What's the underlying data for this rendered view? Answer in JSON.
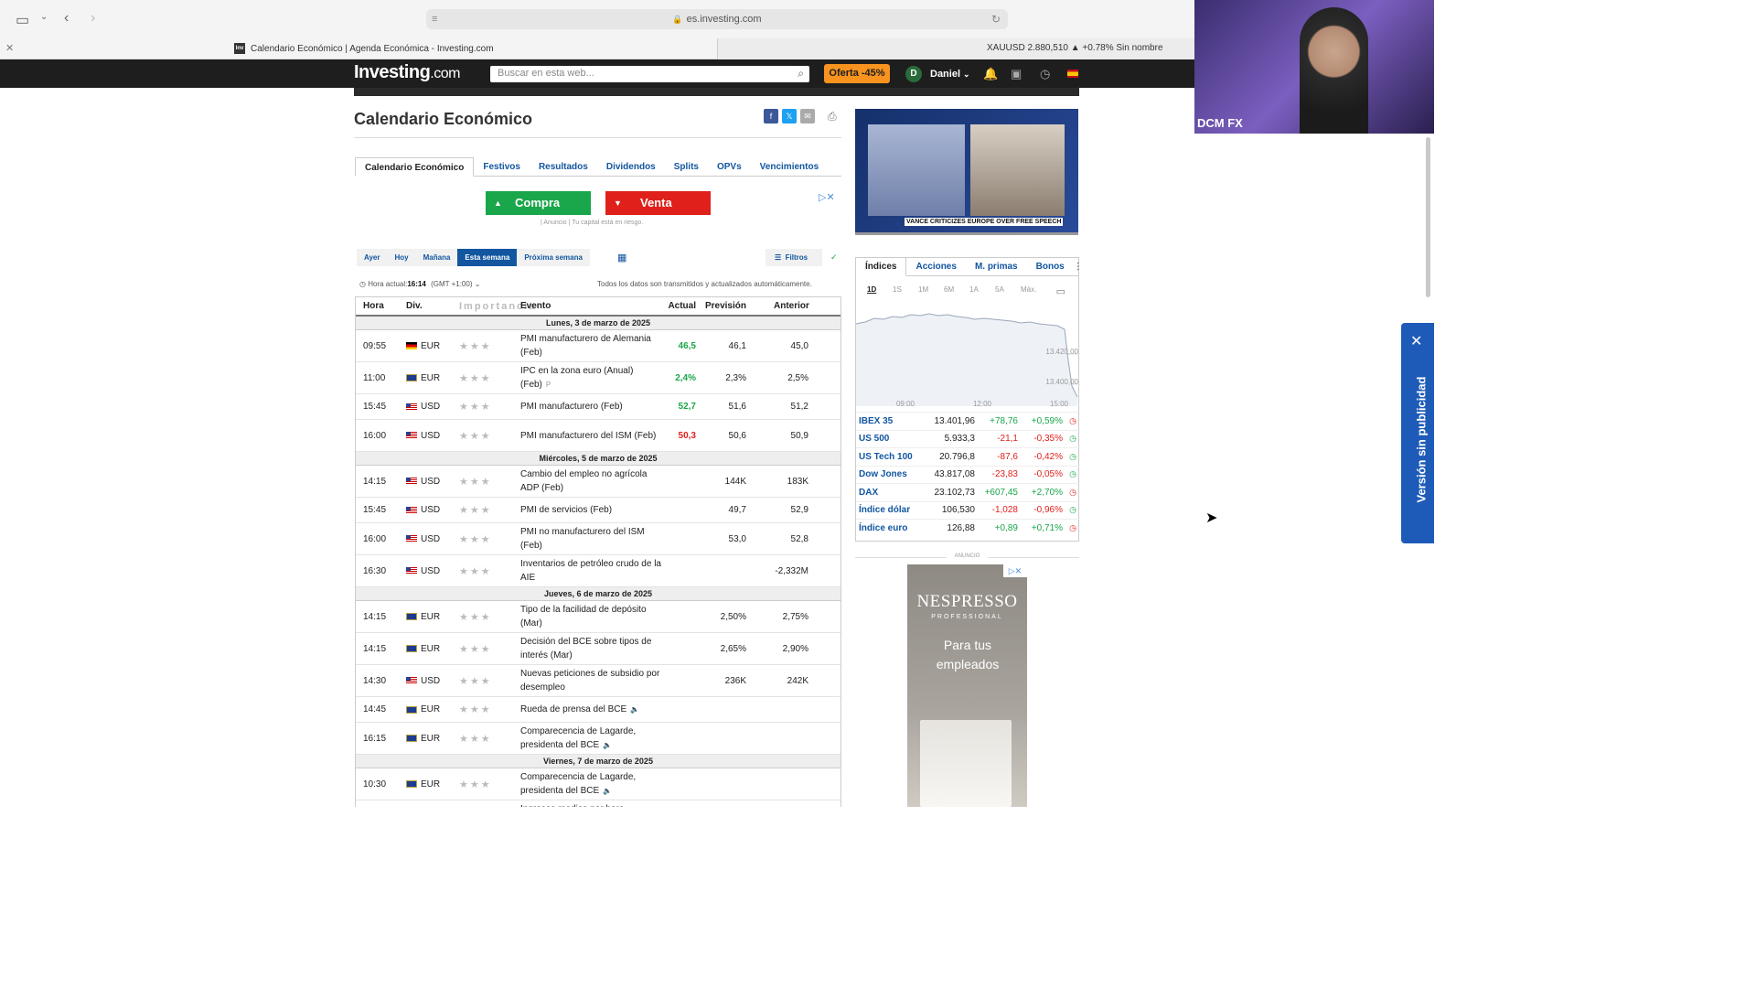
{
  "browser": {
    "url": "es.investing.com",
    "tab_title": "Calendario Económico | Agenda Económica - Investing.com",
    "tab_favicon": "Inv",
    "tab_right_text": "XAUUSD 2.880,510 ▲ +0.78% Sin nombre"
  },
  "header": {
    "logo": "Investing",
    "logo_suffix": ".com",
    "search_placeholder": "Buscar en esta web...",
    "offer_label": "Oferta -45%",
    "user_initial": "D",
    "user_name": "Daniel"
  },
  "page": {
    "title": "Calendario Económico",
    "subtabs": [
      "Calendario Económico",
      "Festivos",
      "Resultados",
      "Dividendos",
      "Splits",
      "OPVs",
      "Vencimientos"
    ],
    "buy_label": "Compra",
    "sell_label": "Venta",
    "ad_note": "| Anuncio | Tu capital está en riesgo.",
    "day_filters": [
      "Ayer",
      "Hoy",
      "Mañana",
      "Esta semana",
      "Próxima semana"
    ],
    "filters_label": "Filtros",
    "time_label": "Hora actual:",
    "time_value": "16:14",
    "tz": "(GMT +1:00)",
    "auto_update": "Todos los datos son transmitidos y actualizados automáticamente."
  },
  "calendar": {
    "headers": [
      "Hora",
      "Div.",
      "Importancia",
      "Evento",
      "Actual",
      "Previsión",
      "Anterior"
    ],
    "days": [
      {
        "label": "Lunes, 3 de marzo de 2025",
        "rows": [
          {
            "time": "09:55",
            "flag": "de",
            "cur": "EUR",
            "event": "PMI manufacturero de Alemania (Feb)",
            "actual": "46,5",
            "actual_color": "green",
            "forecast": "46,1",
            "previous": "45,0"
          },
          {
            "time": "11:00",
            "flag": "eu",
            "cur": "EUR",
            "event": "IPC en la zona euro (Anual) (Feb)",
            "event_mark": "P",
            "actual": "2,4%",
            "actual_color": "green",
            "forecast": "2,3%",
            "previous": "2,5%"
          },
          {
            "time": "15:45",
            "flag": "us",
            "cur": "USD",
            "event": "PMI manufacturero (Feb)",
            "actual": "52,7",
            "actual_color": "green",
            "forecast": "51,6",
            "previous": "51,2"
          },
          {
            "time": "16:00",
            "flag": "us",
            "cur": "USD",
            "event": "PMI manufacturero del ISM (Feb)",
            "actual": "50,3",
            "actual_color": "red",
            "forecast": "50,6",
            "previous": "50,9"
          }
        ]
      },
      {
        "label": "Miércoles, 5 de marzo de 2025",
        "rows": [
          {
            "time": "14:15",
            "flag": "us",
            "cur": "USD",
            "event": "Cambio del empleo no agrícola ADP (Feb)",
            "actual": "",
            "forecast": "144K",
            "previous": "183K"
          },
          {
            "time": "15:45",
            "flag": "us",
            "cur": "USD",
            "event": "PMI de servicios (Feb)",
            "actual": "",
            "forecast": "49,7",
            "previous": "52,9"
          },
          {
            "time": "16:00",
            "flag": "us",
            "cur": "USD",
            "event": "PMI no manufacturero del ISM (Feb)",
            "actual": "",
            "forecast": "53,0",
            "previous": "52,8"
          },
          {
            "time": "16:30",
            "flag": "us",
            "cur": "USD",
            "event": "Inventarios de petróleo crudo de la AIE",
            "actual": "",
            "forecast": "",
            "previous": "-2,332M"
          }
        ]
      },
      {
        "label": "Jueves, 6 de marzo de 2025",
        "rows": [
          {
            "time": "14:15",
            "flag": "eu",
            "cur": "EUR",
            "event": "Tipo de la facilidad de depósito (Mar)",
            "actual": "",
            "forecast": "2,50%",
            "previous": "2,75%"
          },
          {
            "time": "14:15",
            "flag": "eu",
            "cur": "EUR",
            "event": "Decisión del BCE sobre tipos de interés (Mar)",
            "actual": "",
            "forecast": "2,65%",
            "previous": "2,90%"
          },
          {
            "time": "14:30",
            "flag": "us",
            "cur": "USD",
            "event": "Nuevas peticiones de subsidio por desempleo",
            "actual": "",
            "forecast": "236K",
            "previous": "242K"
          },
          {
            "time": "14:45",
            "flag": "eu",
            "cur": "EUR",
            "event": "Rueda de prensa del BCE",
            "sound": true,
            "actual": "",
            "forecast": "",
            "previous": ""
          },
          {
            "time": "16:15",
            "flag": "eu",
            "cur": "EUR",
            "event": "Comparecencia de Lagarde, presidenta del BCE",
            "sound": true,
            "actual": "",
            "forecast": "",
            "previous": ""
          }
        ]
      },
      {
        "label": "Viernes, 7 de marzo de 2025",
        "rows": [
          {
            "time": "10:30",
            "flag": "eu",
            "cur": "EUR",
            "event": "Comparecencia de Lagarde, presidenta del BCE",
            "sound": true,
            "actual": "",
            "forecast": "",
            "previous": ""
          },
          {
            "time": "",
            "flag": "",
            "cur": "",
            "event": "Ingresos medios por hora",
            "actual": "",
            "forecast": "",
            "previous": ""
          }
        ]
      }
    ]
  },
  "video": {
    "caption": "VANCE CRITICIZES EUROPE OVER FREE SPEECH"
  },
  "markets": {
    "tabs": [
      "Índices",
      "Acciones",
      "M. primas",
      "Bonos"
    ],
    "ranges": [
      "1D",
      "1S",
      "1M",
      "6M",
      "1A",
      "5A",
      "Máx."
    ],
    "chart_y_labels": [
      "13.420,00",
      "13.400,00"
    ],
    "chart_x_labels": [
      "09:00",
      "12:00",
      "15:00"
    ],
    "quotes": [
      {
        "name": "IBEX 35",
        "last": "13.401,96",
        "chg": "+78,76",
        "pct": "+0,59%",
        "dir": "up",
        "clock": "red"
      },
      {
        "name": "US 500",
        "last": "5.933,3",
        "chg": "-21,1",
        "pct": "-0,35%",
        "dir": "down",
        "clock": "green"
      },
      {
        "name": "US Tech 100",
        "last": "20.796,8",
        "chg": "-87,6",
        "pct": "-0,42%",
        "dir": "down",
        "clock": "green"
      },
      {
        "name": "Dow Jones",
        "last": "43.817,08",
        "chg": "-23,83",
        "pct": "-0,05%",
        "dir": "down",
        "clock": "green"
      },
      {
        "name": "DAX",
        "last": "23.102,73",
        "chg": "+607,45",
        "pct": "+2,70%",
        "dir": "up",
        "clock": "red"
      },
      {
        "name": "Índice dólar",
        "last": "106,530",
        "chg": "-1,028",
        "pct": "-0,96%",
        "dir": "down",
        "clock": "green"
      },
      {
        "name": "Índice euro",
        "last": "126,88",
        "chg": "+0,89",
        "pct": "+0,71%",
        "dir": "up",
        "clock": "red"
      }
    ]
  },
  "ad": {
    "label": "ANUNCIO",
    "brand": "NESPRESSO",
    "brand_sub": "PROFESSIONAL",
    "slogan": "Para tus empleados"
  },
  "webcam": {
    "label": "DCM FX"
  },
  "side_ad": {
    "label": "Versión sin publicidad"
  },
  "colors": {
    "positive": "#1aa64a",
    "negative": "#e0201b",
    "link": "#1256a0",
    "header": "#1e1e1e",
    "offer": "#f7931e"
  }
}
